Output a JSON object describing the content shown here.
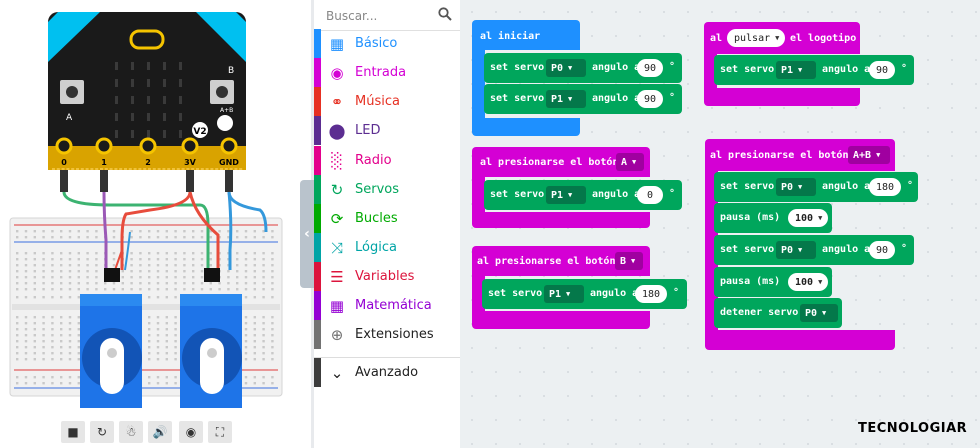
{
  "simulator": {
    "pin_labels": [
      "0",
      "1",
      "2",
      "3V",
      "GND"
    ],
    "btn_a_label": "A",
    "btn_b_label": "B",
    "ab_label": "A+B",
    "v2_label": "V2",
    "controls": [
      "stop-icon",
      "restart-icon",
      "debug-icon",
      "sound-icon",
      "screenshot-icon",
      "fullscreen-icon"
    ]
  },
  "toolbox": {
    "search_placeholder": "Buscar...",
    "categories": [
      {
        "label": "Básico",
        "color": "#1e90ff",
        "icon": "grid-icon"
      },
      {
        "label": "Entrada",
        "color": "#d400d4",
        "icon": "circle-dot-icon"
      },
      {
        "label": "Música",
        "color": "#e63022",
        "icon": "headphones-icon"
      },
      {
        "label": "LED",
        "color": "#5c2d91",
        "icon": "toggle-icon"
      },
      {
        "label": "Radio",
        "color": "#e3008c",
        "icon": "signal-bars-icon"
      },
      {
        "label": "Servos",
        "color": "#00a65c",
        "icon": "sync-icon"
      },
      {
        "label": "Bucles",
        "color": "#00aa00",
        "icon": "refresh-icon"
      },
      {
        "label": "Lógica",
        "color": "#00a4a6",
        "icon": "shuffle-icon"
      },
      {
        "label": "Variables",
        "color": "#dc143c",
        "icon": "list-icon"
      },
      {
        "label": "Matemática",
        "color": "#9400d3",
        "icon": "calculator-icon"
      },
      {
        "label": "Extensiones",
        "color": "#727272",
        "icon": "plus-circle-icon"
      },
      {
        "label": "Avanzado",
        "color": "#3c3c3c",
        "icon": "chevron-down-icon"
      }
    ]
  },
  "blocks": {
    "al_iniciar": {
      "hat": "al iniciar",
      "cmd1": {
        "verb": "set servo",
        "pin": "P0",
        "mid": "angulo a",
        "value": "90",
        "unit": "°"
      },
      "cmd2": {
        "verb": "set servo",
        "pin": "P1",
        "mid": "angulo a",
        "value": "90",
        "unit": "°"
      }
    },
    "boton_a": {
      "hat": "al presionarse el botón",
      "button": "A",
      "cmd1": {
        "verb": "set servo",
        "pin": "P1",
        "mid": "angulo a",
        "value": "0",
        "unit": "°"
      }
    },
    "boton_b": {
      "hat": "al presionarse el botón",
      "button": "B",
      "cmd1": {
        "verb": "set servo",
        "pin": "P1",
        "mid": "angulo a",
        "value": "180",
        "unit": "°"
      }
    },
    "logo": {
      "hat_pre": "al",
      "action": "pulsar",
      "hat_post": "el logotipo",
      "cmd1": {
        "verb": "set servo",
        "pin": "P1",
        "mid": "angulo a",
        "value": "90",
        "unit": "°"
      }
    },
    "boton_ab": {
      "hat": "al presionarse el botón",
      "button": "A+B",
      "cmd1": {
        "verb": "set servo",
        "pin": "P0",
        "mid": "angulo a",
        "value": "180",
        "unit": "°"
      },
      "pause1": {
        "verb": "pausa (ms)",
        "value": "100"
      },
      "cmd2": {
        "verb": "set servo",
        "pin": "P0",
        "mid": "angulo a",
        "value": "90",
        "unit": "°"
      },
      "pause2": {
        "verb": "pausa (ms)",
        "value": "100"
      },
      "stop": {
        "verb": "detener servo",
        "pin": "P0"
      }
    }
  },
  "colors": {
    "input_block": "#d400d4",
    "basic_block": "#1e90ff",
    "servo_block": "#00a65c",
    "servo_dropdown": "#04784a"
  },
  "brand": "TECNOLOGIAR"
}
